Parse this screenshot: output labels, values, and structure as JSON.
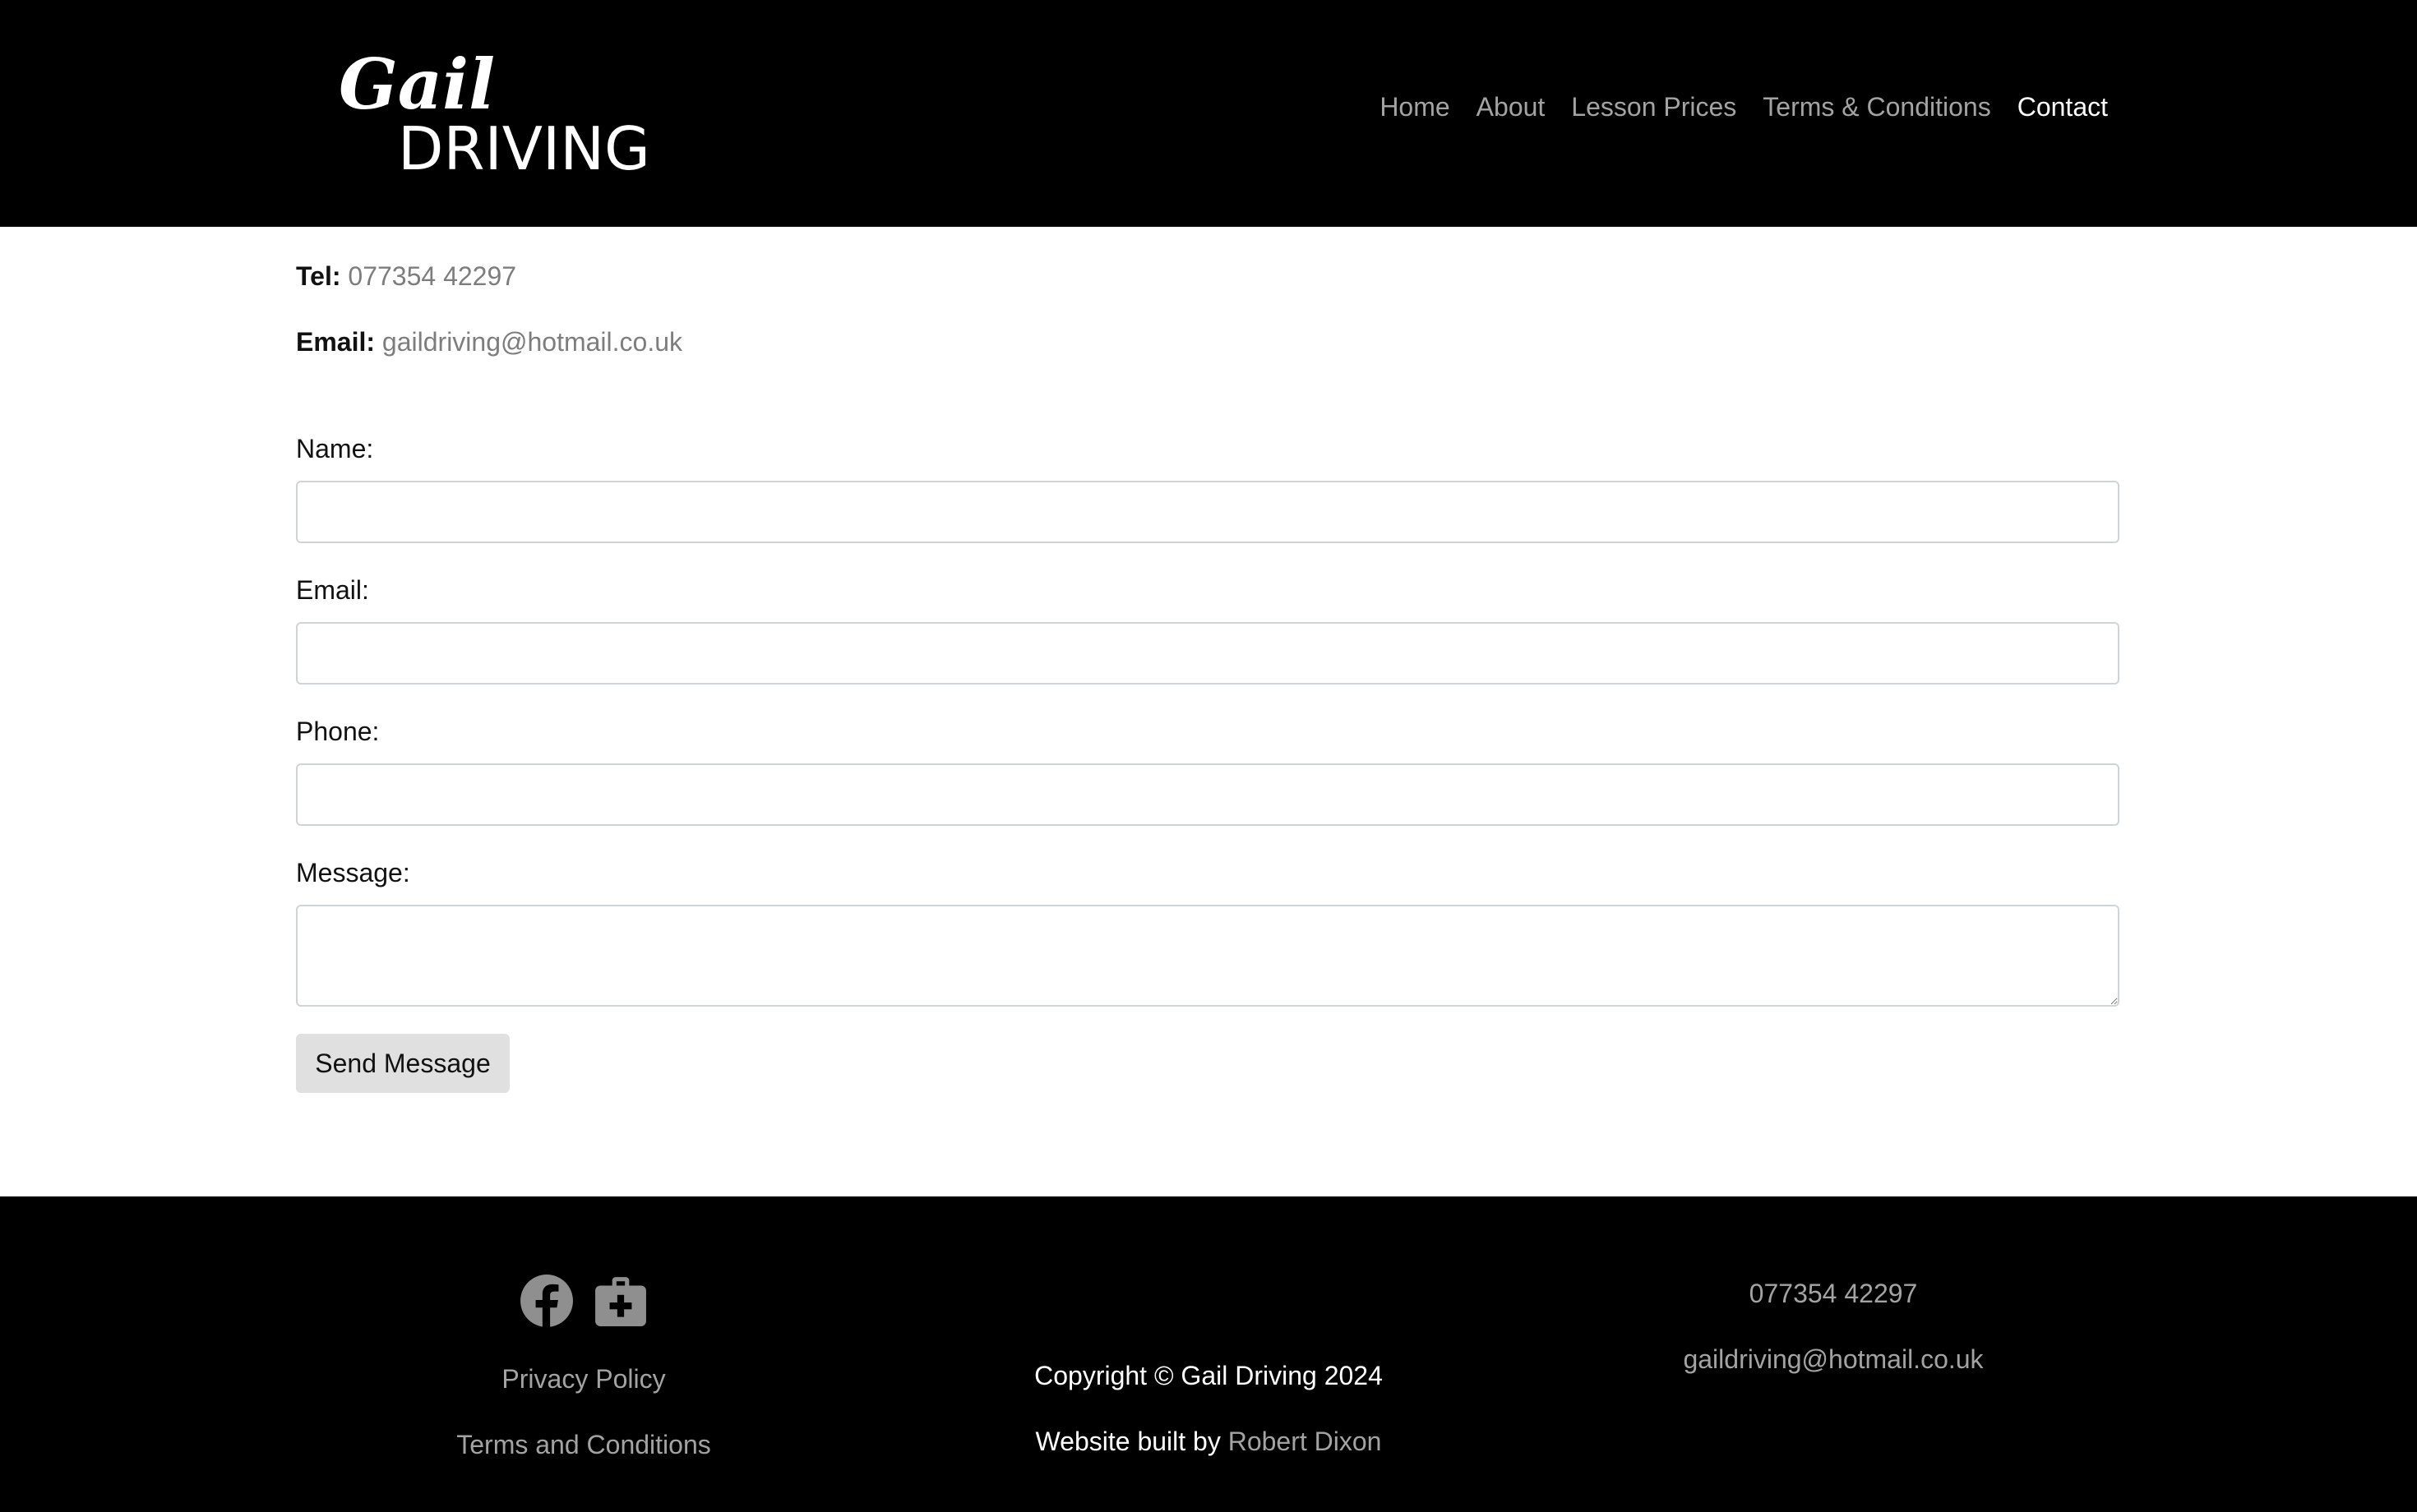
{
  "brand": {
    "logo_line1": "Gail",
    "logo_line2": "DRIVING"
  },
  "nav": {
    "items": [
      {
        "label": "Home"
      },
      {
        "label": "About"
      },
      {
        "label": "Lesson Prices"
      },
      {
        "label": "Terms & Conditions"
      },
      {
        "label": "Contact"
      }
    ],
    "active": "Contact"
  },
  "contact_info": {
    "tel_label": "Tel:",
    "tel_value": "077354 42297",
    "email_label": "Email:",
    "email_value": "gaildriving@hotmail.co.uk"
  },
  "form": {
    "name_label": "Name:",
    "name_value": "",
    "email_label": "Email:",
    "email_value": "",
    "phone_label": "Phone:",
    "phone_value": "",
    "message_label": "Message:",
    "message_value": "",
    "submit_label": "Send Message"
  },
  "footer": {
    "social_icons": [
      "facebook-icon",
      "medical-kit-icon"
    ],
    "privacy_label": "Privacy Policy",
    "terms_label": "Terms and Conditions",
    "copyright": "Copyright © Gail Driving 2024",
    "built_by_prefix": "Website built by",
    "built_by_name": "Robert Dixon",
    "tel": "077354 42297",
    "email": "gaildriving@hotmail.co.uk"
  },
  "colors": {
    "header_bg": "#000000",
    "footer_bg": "#000000",
    "nav_link": "#a3a3a3",
    "nav_active": "#ffffff",
    "link_grey": "#7d7d7d",
    "button_bg": "#e0e0e0"
  }
}
